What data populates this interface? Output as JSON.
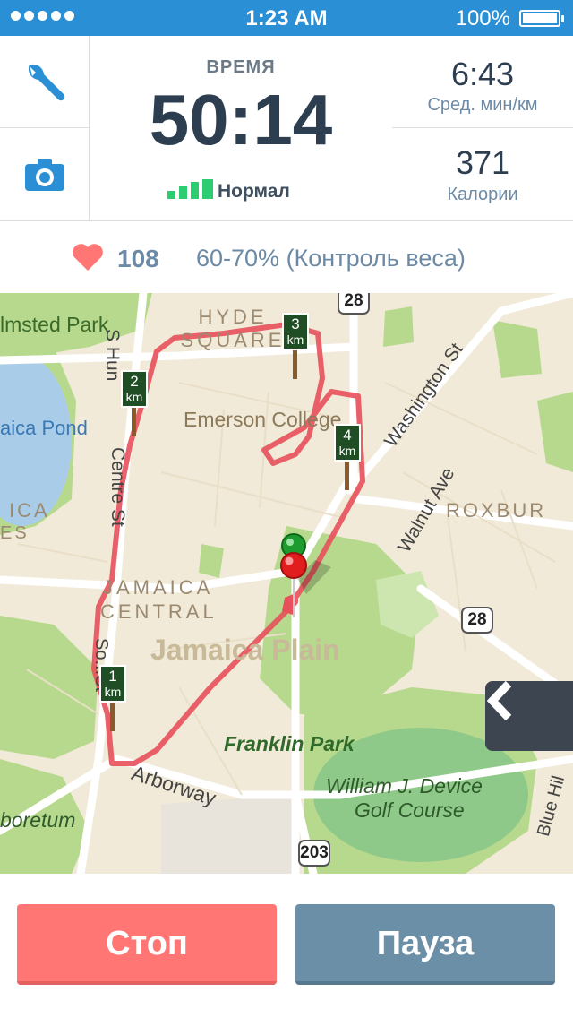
{
  "status_bar": {
    "time": "1:23 AM",
    "battery": "100%"
  },
  "stats": {
    "main_label": "ВРЕМЯ",
    "main_value": "50:14",
    "signal_label": "Нормал",
    "pace_value": "6:43",
    "pace_caption": "Сред. мин/км",
    "calories_value": "371",
    "calories_caption": "Калории"
  },
  "heart": {
    "bpm": "108",
    "zone": "60-70% (Контроль веса)"
  },
  "map": {
    "labels": {
      "olmsted_park": "lmsted Park",
      "hyde_square": "HYDE SQUARE",
      "emerson": "Emerson College",
      "washington": "Washington St",
      "jamaica_pond": "aica Pond",
      "centre_st": "Centre St",
      "walnut_ave": "Walnut Ave",
      "roxbury": "ROXBUR",
      "jamaica_central_1": "JAMAICA",
      "jamaica_central_2": "CENTRAL",
      "jamaica_plain": "Jamaica Plain",
      "franklin_park": "Franklin Park",
      "golf_1": "William J. Device",
      "golf_2": "Golf Course",
      "arborway": "Arborway",
      "arboretum": "boretum",
      "blue_hill": "Blue Hil",
      "s_hun": "S Hun",
      "south_st": "So...St",
      "ica_left": "ICA",
      "es_left": "ES"
    },
    "markers": [
      {
        "num": "1",
        "unit": "km"
      },
      {
        "num": "2",
        "unit": "km"
      },
      {
        "num": "3",
        "unit": "km"
      },
      {
        "num": "4",
        "unit": "km"
      }
    ],
    "shields": [
      "28",
      "28",
      "203"
    ]
  },
  "buttons": {
    "stop": "Стоп",
    "pause": "Пауза"
  },
  "colors": {
    "status_bar": "#2a8fd4",
    "stop": "#ff7675",
    "pause": "#6c8fa8",
    "route": "#e8505b",
    "signal": "#2ecc71"
  }
}
